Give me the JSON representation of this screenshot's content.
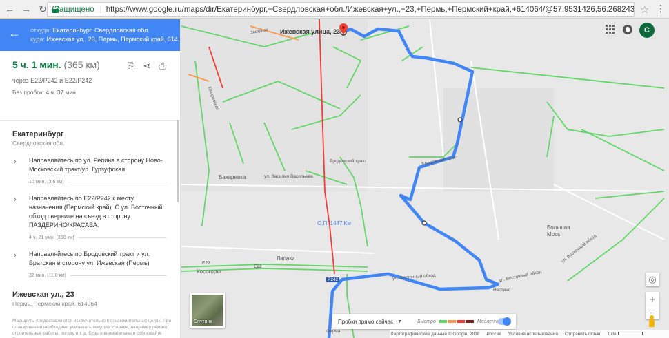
{
  "browser": {
    "secure_label": "Защищено",
    "url": "https://www.google.ru/maps/dir/Екатеринбург,+Свердловская+обл./Ижевская+ул.,+23,+Пермь,+Пермский+край,+614064/@57.9531426,56.2682435,13z/am=t/data..."
  },
  "directions": {
    "from_label": "откуда:",
    "from_value": "Екатеринбург, Свердловская обл.",
    "to_label": "куда:",
    "to_value": "Ижевская ул., 23, Пермь, Пермский край, 614..."
  },
  "summary": {
    "time": "5 ч. 1 мин.",
    "distance": "(365 км)",
    "via": "через Е22/Р242 и Е22/Р242",
    "no_traffic": "Без пробок: 4 ч. 37 мин."
  },
  "origin": {
    "name": "Екатеринбург",
    "region": "Свердловская обл."
  },
  "steps": [
    {
      "text": "Направляйтесь по ул. Репина в сторону Ново-Московский тракт/ул. Гурзуфская",
      "meta": "10 мин. (3,6 км)"
    },
    {
      "text": "Направляйтесь по Е22/Р242 к месту назначения (Пермский край). С ул. Восточный обход сверните на съезд в сторону ПАЗДЕРИНО/КРАСАВА.",
      "meta": "4 ч. 21 мин. (350 км)"
    },
    {
      "text": "Направляйтесь по Бродовский тракт и ул. Братская в сторону ул. Ижевская (Пермь)",
      "meta": "32 мин. (11,0 км)"
    }
  ],
  "destination": {
    "name": "Ижевская ул., 23",
    "address": "Пермь, Пермский край, 614064"
  },
  "disclaimer": "Маршруты предоставляются исключительно в ознакомительных целях. При планировании необходимо учитывать текущие условия, например ремонт, строительные работы, погоду и т. д. Будьте внимательны и соблюдайте Правила дорожного движения.",
  "map": {
    "dest_label": "Ижевская улица, 23",
    "labels": {
      "baxarevka": "Бахаревка",
      "op": "О.П. 1447 Км",
      "lipaki": "Липаки",
      "kosogory": "Косогоры",
      "bolshaya_mos": "Большая\nМось",
      "brodovsky": "Бродовский тракт",
      "brodovsky2": "Бродовский тракт",
      "vostochny": "ул. Восточный обход",
      "vostochny2": "ул. Восточный обход",
      "vostochny3": "ул. Восточный обход",
      "vasilya": "ул. Василия Васильева",
      "e22a": "E22",
      "e22b": "E22",
      "p242": "Р242",
      "nesino": "Нестино",
      "ferma": "Ферма",
      "bakharevskaya": "Бахаревская",
      "zvezdnaya": "Звездная"
    },
    "avatar_letter": "C",
    "satellite_label": "Спутник",
    "traffic_select": "Пробки прямо сейчас",
    "legend_fast": "Быстро",
    "legend_slow": "Медленно",
    "legend_colors": [
      "#63d668",
      "#ff974d",
      "#f23c32",
      "#811f1f"
    ],
    "route_color": "#4285f4",
    "footer": {
      "data": "Картографические данные © Google, 2018",
      "region": "Россия",
      "terms": "Условия использования",
      "feedback": "Отправить отзыв",
      "scale": "1 км"
    }
  }
}
